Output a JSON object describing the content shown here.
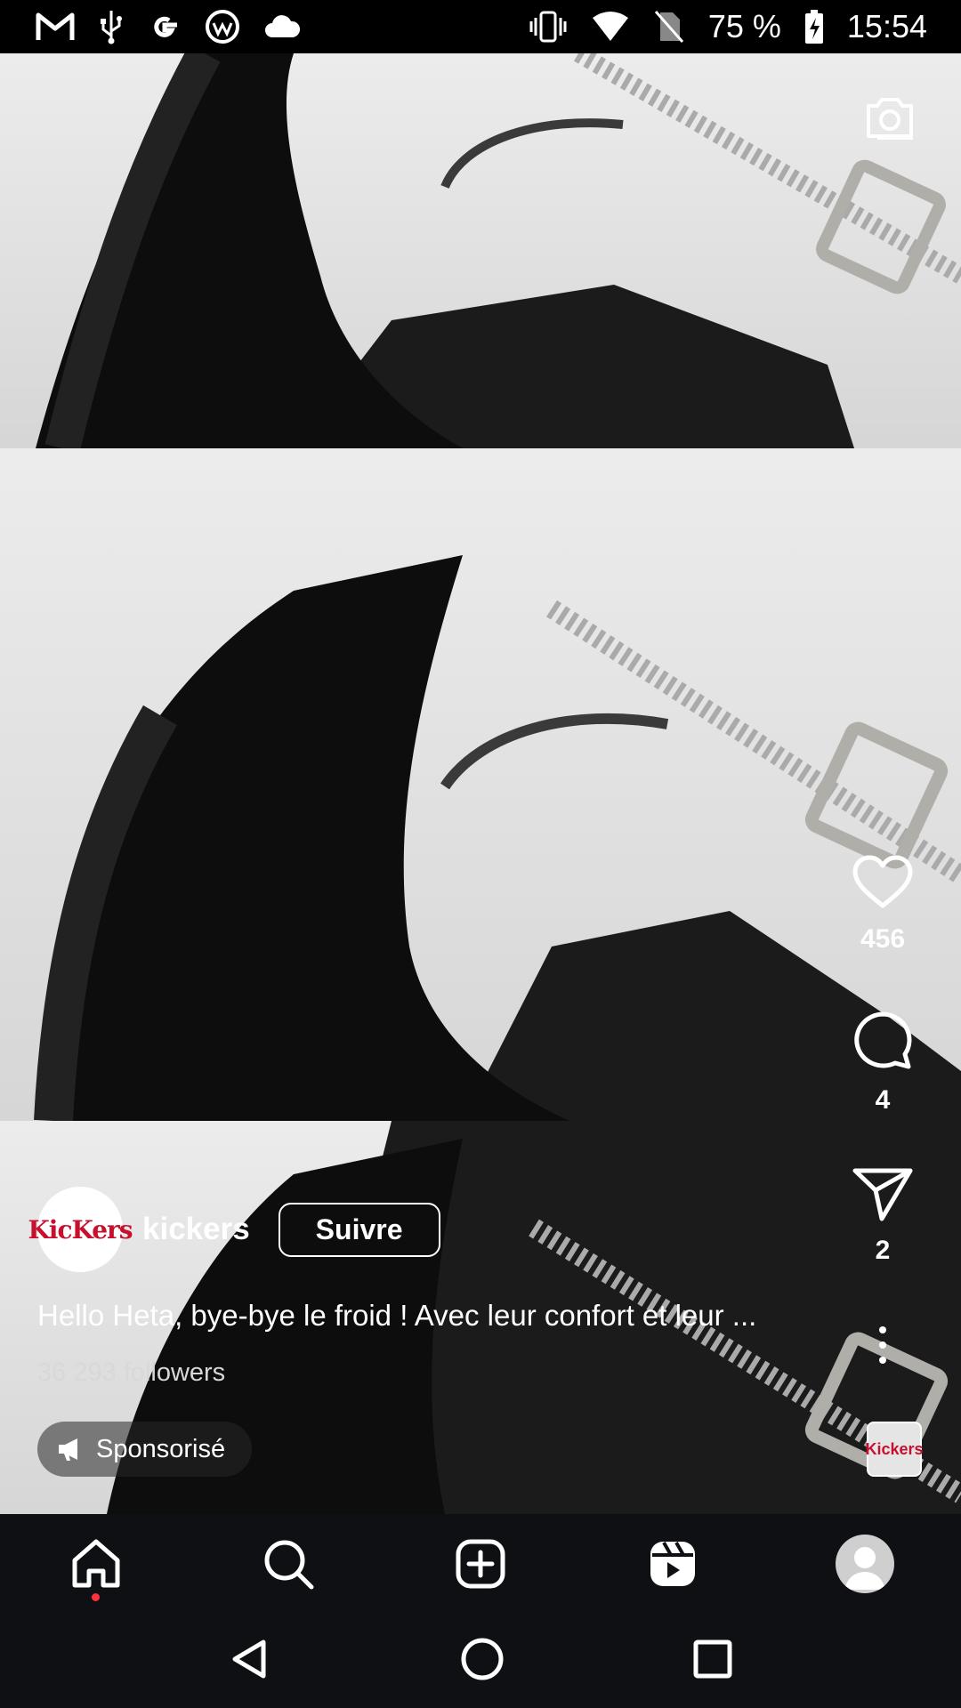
{
  "status_bar": {
    "left_icons": [
      "gmail-icon",
      "usb-icon",
      "google-icon",
      "vpn-icon",
      "cloud-icon"
    ],
    "battery_percent": "75 %",
    "time": "15:54"
  },
  "post": {
    "username": "kickers",
    "avatar_text": "KicKers",
    "follow_label": "Suivre",
    "caption": "Hello Heta, bye-bye le froid ! Avec leur confort et leur ...",
    "followers": "36 293 followers",
    "sponsored_label": "Sponsorisé",
    "likes": "456",
    "comments": "4",
    "shares": "2",
    "music_thumb_text": "Kickers"
  },
  "nav": {
    "items": [
      "home-icon",
      "search-icon",
      "create-icon",
      "reels-icon",
      "profile-icon"
    ]
  },
  "colors": {
    "nav_background": "#0f1014",
    "brand_red": "#c8102e",
    "notification_dot": "#ff3040"
  }
}
